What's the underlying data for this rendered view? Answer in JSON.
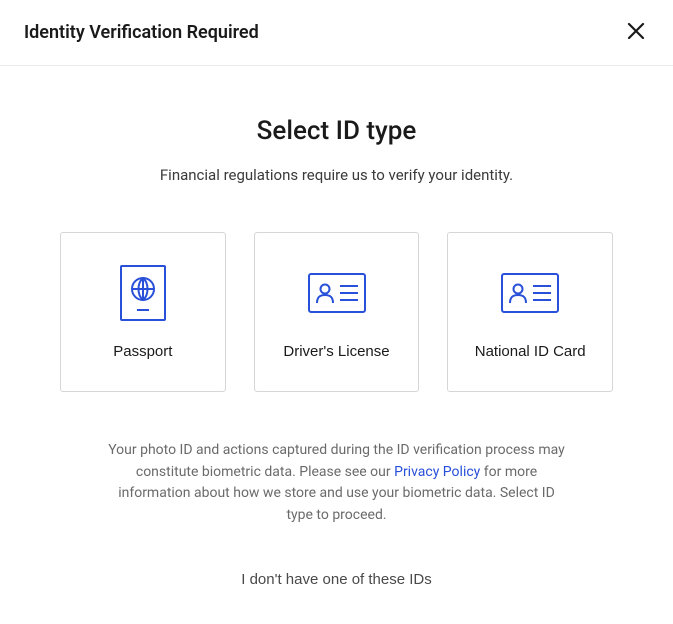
{
  "header": {
    "title": "Identity Verification Required"
  },
  "main": {
    "title": "Select ID type",
    "subtitle": "Financial regulations require us to verify your identity."
  },
  "idTypes": [
    {
      "label": "Passport",
      "icon": "passport-icon"
    },
    {
      "label": "Driver's License",
      "icon": "id-card-icon"
    },
    {
      "label": "National ID Card",
      "icon": "id-card-icon"
    }
  ],
  "disclaimer": {
    "part1": "Your photo ID and actions captured during the ID verification process may constitute biometric data. Please see our ",
    "linkText": "Privacy Policy",
    "part2": " for more information about how we store and use your biometric data. Select ID type to proceed."
  },
  "fallback": {
    "label": "I don't have one of these IDs"
  },
  "colors": {
    "accent": "#2850d9"
  }
}
